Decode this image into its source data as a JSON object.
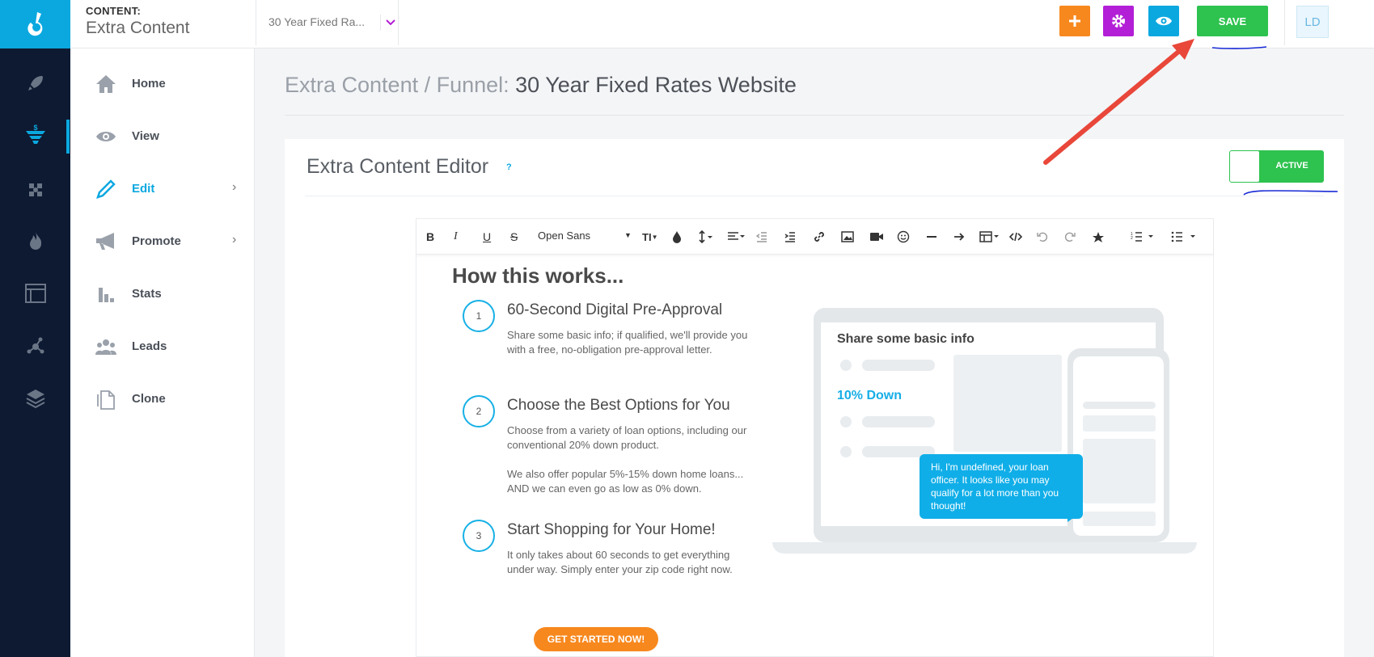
{
  "header": {
    "section_label": "CONTENT:",
    "section_title": "Extra Content",
    "funnel_select_value": "30 Year Fixed Ra...",
    "save_label": "SAVE",
    "avatar_initials": "LD"
  },
  "rail": {
    "icons": [
      "logo-icon",
      "rocket-icon",
      "funnel-icon",
      "puzzle-icon",
      "fire-icon",
      "browser-icon",
      "network-icon",
      "layers-icon"
    ],
    "active_index": 2
  },
  "menu": {
    "items": [
      {
        "label": "Home",
        "icon": "home-icon"
      },
      {
        "label": "View",
        "icon": "eye-icon"
      },
      {
        "label": "Edit",
        "icon": "pencil-icon"
      },
      {
        "label": "Promote",
        "icon": "megaphone-icon"
      },
      {
        "label": "Stats",
        "icon": "bar-chart-icon"
      },
      {
        "label": "Leads",
        "icon": "people-icon"
      },
      {
        "label": "Clone",
        "icon": "copy-icon"
      }
    ]
  },
  "page": {
    "title_prefix": "Extra Content / Funnel: ",
    "title_name": "30 Year Fixed Rates Website"
  },
  "editor_card": {
    "title": "Extra Content Editor",
    "help": "?",
    "toggle_label": "ACTIVE",
    "font_family_value": "Open Sans"
  },
  "content": {
    "heading": "How this works...",
    "steps": [
      {
        "num": "1",
        "title": "60-Second Digital Pre-Approval",
        "text": "Share some basic info; if qualified, we'll provide you with a free, no-obligation pre-approval letter.",
        "text2": ""
      },
      {
        "num": "2",
        "title": "Choose the Best Options for You",
        "text": "Choose from a variety of loan options, including our conventional 20% down product.",
        "text2": "We also offer popular 5%-15% down home loans... AND we can even go as low as 0% down."
      },
      {
        "num": "3",
        "title": "Start Shopping for Your Home!",
        "text": "It only takes about 60 seconds to get everything under way. Simply enter your zip code right now.",
        "text2": ""
      }
    ],
    "cta_label": "GET STARTED NOW!",
    "illustration": {
      "share_title": "Share some basic info",
      "down_label": "10% Down",
      "bubble_text": "Hi, I'm undefined, your loan officer. It looks like you may qualify for a lot more than you thought!"
    }
  },
  "colors": {
    "brand_blue": "#0ba8e0",
    "rail_bg": "#0e1a32",
    "add_orange": "#f7881e",
    "settings_purple": "#b21fd6",
    "preview_blue": "#0ba8e0",
    "save_green": "#2ec24f",
    "annotation_red": "#e8473a"
  }
}
